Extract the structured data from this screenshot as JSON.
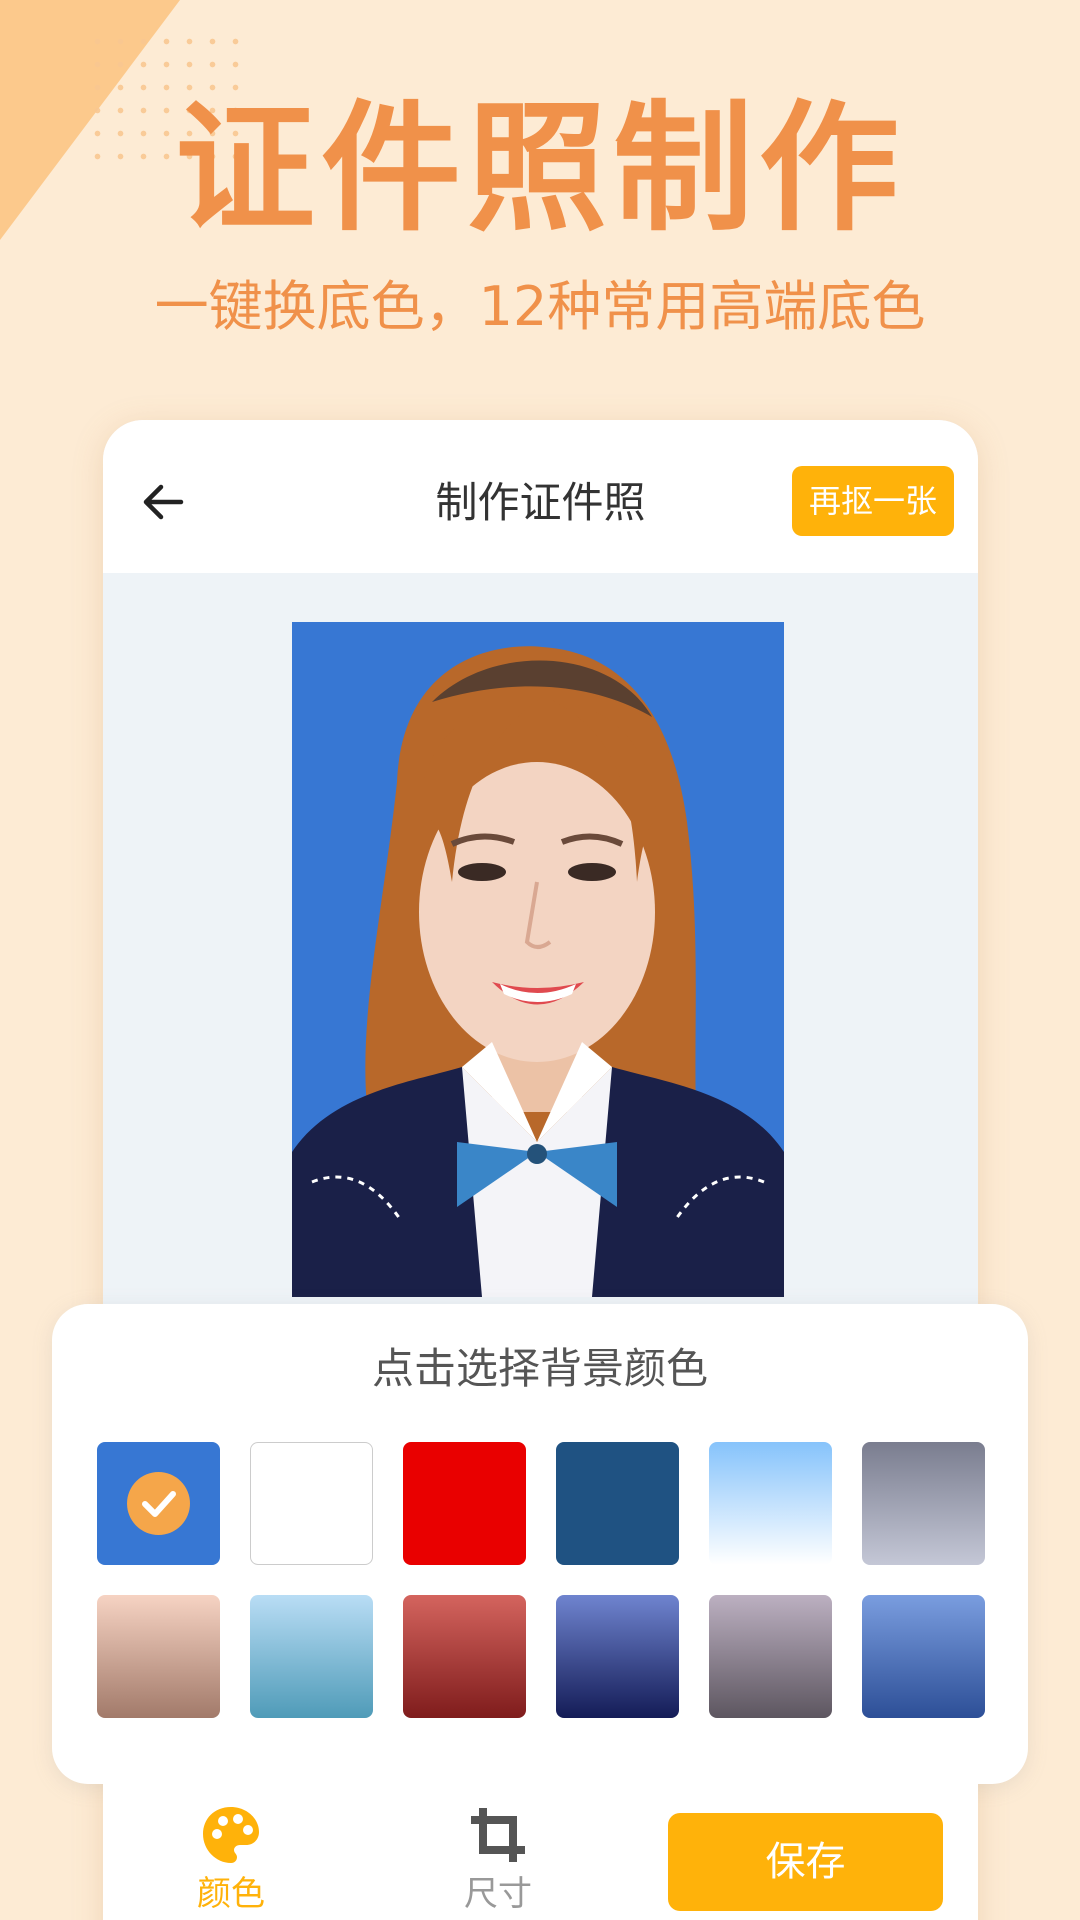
{
  "promo": {
    "title": "证件照制作",
    "subtitle": "一键换底色，12种常用高端底色"
  },
  "header": {
    "back_icon": "arrow-left-icon",
    "title": "制作证件照",
    "recrop_label": "再抠一张"
  },
  "photo": {
    "background_color": "#3777d3"
  },
  "panel": {
    "title": "点击选择背景颜色",
    "selected_index": 0,
    "swatches": [
      {
        "name": "blue",
        "fill": "#3777d3"
      },
      {
        "name": "white",
        "fill": "#ffffff"
      },
      {
        "name": "red",
        "fill": "#e90000"
      },
      {
        "name": "navy",
        "fill": "#1f5282"
      },
      {
        "name": "sky-gradient",
        "fill": "linear-gradient(#86c3fb,#ffffff)"
      },
      {
        "name": "gray-gradient",
        "fill": "linear-gradient(#7a7d8f,#c4c7d6)"
      },
      {
        "name": "peach-gradient",
        "fill": "linear-gradient(#f6d3c3,#a27a6a)"
      },
      {
        "name": "cyan-gradient",
        "fill": "linear-gradient(#b9ddf5,#4f9bb8)"
      },
      {
        "name": "maroon-gradient",
        "fill": "linear-gradient(#d4645e,#7f1c1c)"
      },
      {
        "name": "indigo-gradient",
        "fill": "linear-gradient(#6f84cf,#141c57)"
      },
      {
        "name": "mauve-gradient",
        "fill": "linear-gradient(#bcb0c1,#5d5660)"
      },
      {
        "name": "cornflower-gradient",
        "fill": "linear-gradient(#7a9ddf,#2d4f97)"
      }
    ]
  },
  "bottom_bar": {
    "color_tab_label": "颜色",
    "size_tab_label": "尺寸",
    "save_label": "保存",
    "active_color": "#ffb20a",
    "inactive_color": "#999999"
  }
}
